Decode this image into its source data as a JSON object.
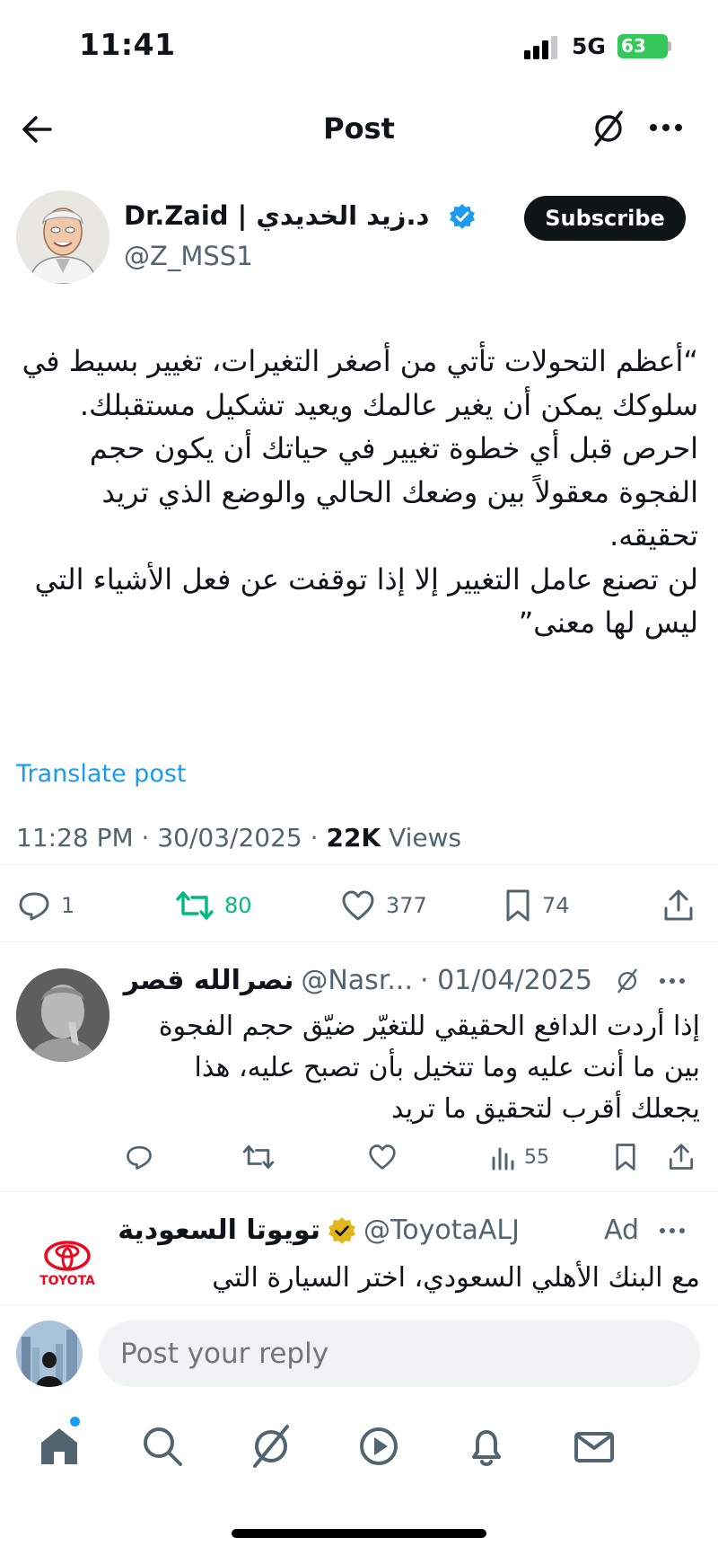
{
  "status_bar": {
    "time": "11:41",
    "network": "5G",
    "battery": "63"
  },
  "header": {
    "title": "Post",
    "icons": [
      "back-arrow-icon",
      "grok-icon",
      "more-icon"
    ]
  },
  "author": {
    "name": "Dr.Zaid | د.زيد الخديدي",
    "handle": "@Z_MSS1",
    "verified": true,
    "subscribe_label": "Subscribe"
  },
  "post": {
    "text": "“أعظم التحولات تأتي من أصغر التغيرات، تغيير بسيط في سلوكك يمكن أن يغير عالمك ويعيد تشكيل مستقبلك.\nاحرص قبل أي خطوة تغيير في حياتك أن يكون حجم الفجوة معقولاً بين وضعك الحالي والوضع الذي تريد تحقيقه.\nلن تصنع عامل التغيير إلا إذا توقفت عن فعل الأشياء التي ليس لها معنى”",
    "translate_label": "Translate post",
    "time": "11:28 PM",
    "date": "30/03/2025",
    "views_count": "22K",
    "views_label": "Views"
  },
  "actions": {
    "replies": "1",
    "reposts": "80",
    "likes": "377",
    "bookmarks": "74"
  },
  "reply": {
    "name": "نصرالله قصر",
    "handle": "@Nasr...",
    "date": "· 01/04/2025",
    "text": "إذا أردت الدافع الحقيقي للتغيّر ضيّق حجم الفجوة بين ما أنت عليه وما تتخيل بأن تصبح عليه، هذا يجعلك أقرب لتحقيق ما تريد",
    "views": "55"
  },
  "ad": {
    "name": "تويوتا السعودية",
    "handle": "@ToyotaALJ",
    "ad_label": "Ad",
    "logo_text": "TOYOTA",
    "text": "مع البنك الأهلي السعودي، اختر السيارة التي"
  },
  "composer": {
    "placeholder": "Post your reply"
  },
  "colors": {
    "accent": "#1d9bf0",
    "repost_green": "#00ba7c",
    "muted": "#536471",
    "text": "#0f1419",
    "toyota_red": "#eb0a1e"
  }
}
